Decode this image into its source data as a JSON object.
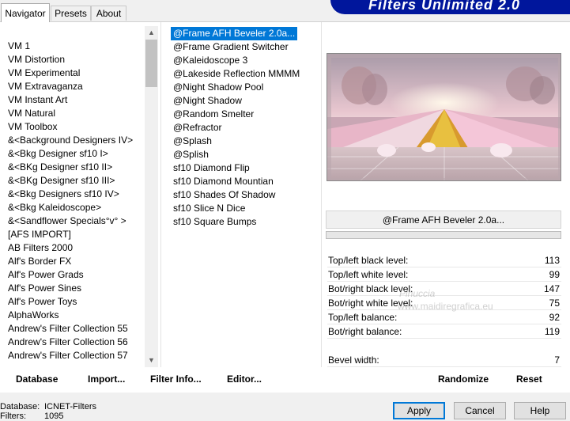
{
  "app": {
    "title": "Filters Unlimited 2.0"
  },
  "tabs": [
    {
      "label": "Navigator",
      "active": true
    },
    {
      "label": "Presets",
      "active": false
    },
    {
      "label": "About",
      "active": false
    }
  ],
  "categories": [
    "VM 1",
    "VM Distortion",
    "VM Experimental",
    "VM Extravaganza",
    "VM Instant Art",
    "VM Natural",
    "VM Toolbox",
    "&<Background Designers IV>",
    "&<Bkg Designer sf10 I>",
    "&<BKg Designer sf10 II>",
    "&<BKg Designer sf10 III>",
    "&<Bkg Designers sf10 IV>",
    "&<Bkg Kaleidoscope>",
    "&<Sandflower Specials°v° >",
    "[AFS IMPORT]",
    "AB Filters 2000",
    "Alf's Border FX",
    "Alf's Power Grads",
    "Alf's Power Sines",
    "Alf's Power Toys",
    "AlphaWorks",
    "Andrew's Filter Collection 55",
    "Andrew's Filter Collection 56",
    "Andrew's Filter Collection 57"
  ],
  "filters": [
    "@Frame AFH Beveler 2.0a...",
    "@Frame Gradient Switcher",
    "@Kaleidoscope 3",
    "@Lakeside Reflection MMMM",
    "@Night Shadow Pool",
    "@Night Shadow",
    "@Random Smelter",
    "@Refractor",
    "@Splash",
    "@Splish",
    "sf10 Diamond Flip",
    "sf10 Diamond Mountian",
    "sf10 Shades Of Shadow",
    "sf10 Slice N Dice",
    "sf10 Square Bumps"
  ],
  "selected_filter": "@Frame AFH Beveler 2.0a...",
  "parameters": [
    {
      "label": "Top/left black level:",
      "value": "113"
    },
    {
      "label": "Top/left white level:",
      "value": "99"
    },
    {
      "label": "Bot/right black level:",
      "value": "147"
    },
    {
      "label": "Bot/right white level:",
      "value": "75"
    },
    {
      "label": "Top/left balance:",
      "value": "92"
    },
    {
      "label": "Bot/right balance:",
      "value": "119"
    }
  ],
  "bevel": {
    "label": "Bevel width:",
    "value": "7"
  },
  "toolbar": {
    "database": "Database",
    "import": "Import...",
    "filter_info": "Filter Info...",
    "editor": "Editor...",
    "randomize": "Randomize",
    "reset": "Reset"
  },
  "status": {
    "database_label": "Database:",
    "database_value": "ICNET-Filters",
    "filters_label": "Filters:",
    "filters_value": "1095"
  },
  "buttons": {
    "apply": "Apply",
    "cancel": "Cancel",
    "help": "Help"
  },
  "watermark": {
    "line1": "Pinuccia",
    "line2": "www.maidiregrafica.eu"
  }
}
